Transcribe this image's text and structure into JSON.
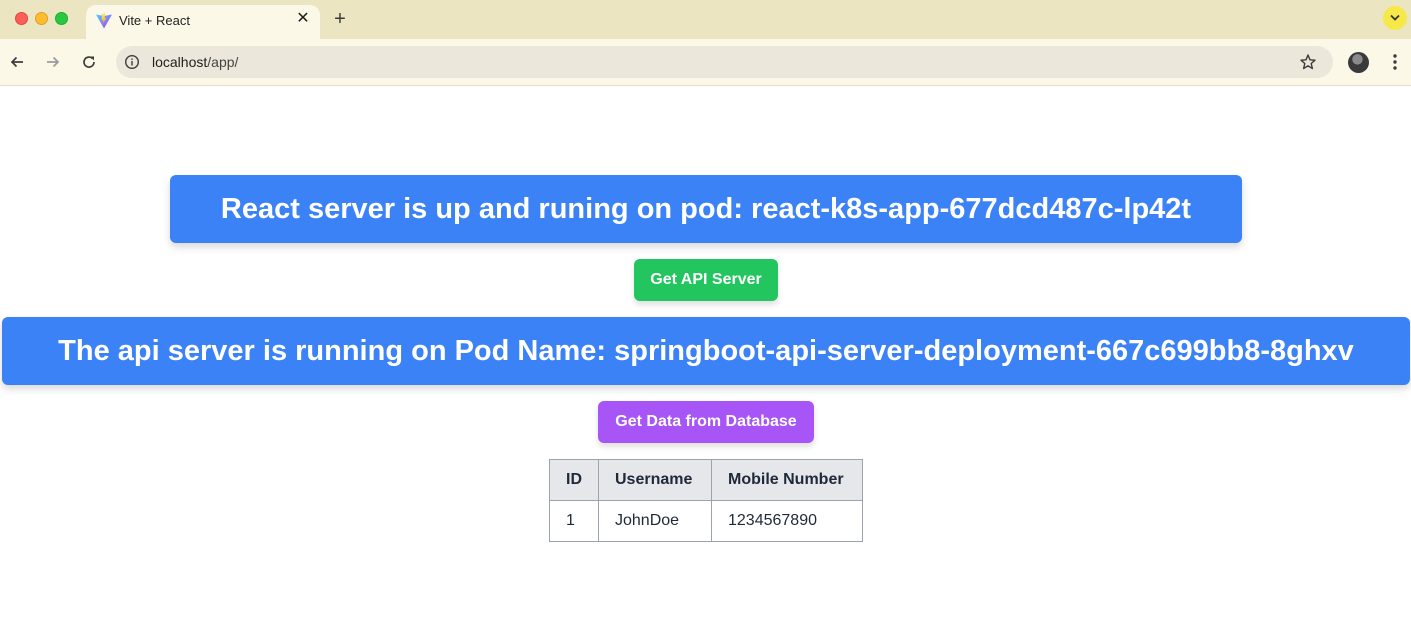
{
  "browser": {
    "tab": {
      "title": "Vite + React"
    },
    "address_bar": {
      "host": "localhost",
      "path": "/app/"
    }
  },
  "page": {
    "react_banner": "React server is up and runing on pod: react-k8s-app-677dcd487c-lp42t",
    "api_button": "Get API Server",
    "api_banner": "The api server is running on Pod Name: springboot-api-server-deployment-667c699bb8-8ghxv",
    "db_button": "Get Data from Database",
    "table": {
      "headers": [
        "ID",
        "Username",
        "Mobile Number"
      ],
      "rows": [
        [
          "1",
          "JohnDoe",
          "1234567890"
        ]
      ]
    }
  },
  "colors": {
    "banner": "#3b82f6",
    "api_button": "#22c55e",
    "db_button": "#a855f7",
    "table_header": "#e5e7eb"
  }
}
